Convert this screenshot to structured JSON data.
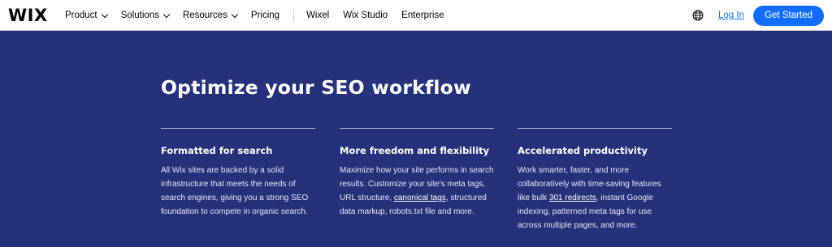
{
  "header": {
    "logo": "WIX",
    "nav": [
      {
        "label": "Product",
        "has_menu": true
      },
      {
        "label": "Solutions",
        "has_menu": true
      },
      {
        "label": "Resources",
        "has_menu": true
      },
      {
        "label": "Pricing",
        "has_menu": false
      }
    ],
    "nav_secondary": [
      {
        "label": "Wixel"
      },
      {
        "label": "Wix Studio"
      },
      {
        "label": "Enterprise"
      }
    ],
    "language_icon": "globe-icon",
    "login_label": "Log In",
    "cta_label": "Get Started",
    "cta_color": "#116dff"
  },
  "hero": {
    "background_color": "#25317a",
    "title": "Optimize your SEO workflow",
    "columns": [
      {
        "title": "Formatted for search",
        "text": "All Wix sites are backed by a solid infrastructure that meets the needs of search engines, giving you a strong SEO foundation to compete in organic search."
      },
      {
        "title": "More freedom and flexibility",
        "text_before": "Maximize how your site performs in search results. Customize your site's meta tags, URL structure, ",
        "link": "canonical tags",
        "text_after": ", structured data markup, robots.txt file and more."
      },
      {
        "title": "Accelerated productivity",
        "text_before": "Work smarter, faster, and more collaboratively with time-saving features like bulk ",
        "link": "301 redirects",
        "text_after": ", instant Google indexing, patterned meta tags for use across multiple pages, and more."
      }
    ]
  }
}
